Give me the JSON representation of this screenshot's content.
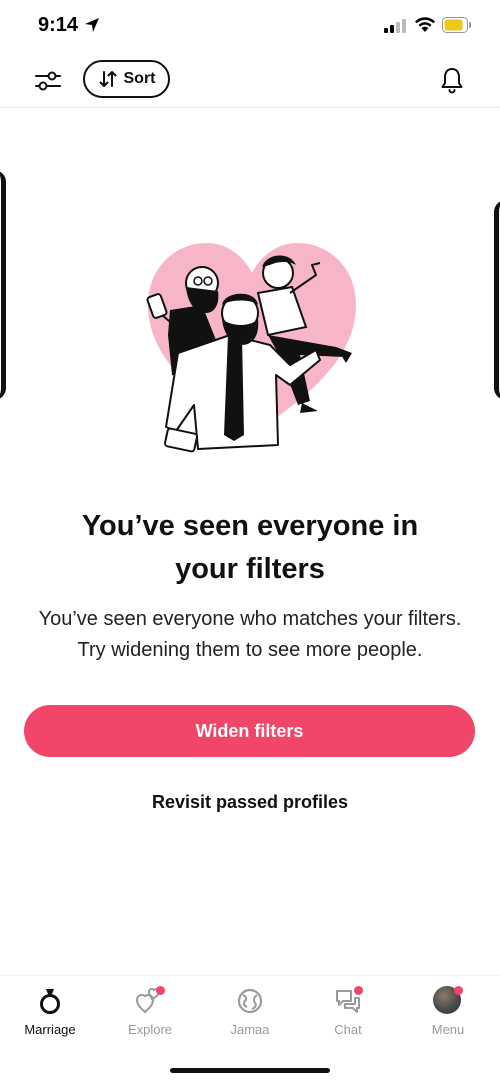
{
  "status_bar": {
    "time": "9:14"
  },
  "toolbar": {
    "filter_icon": "sliders-icon",
    "sort_label": "Sort",
    "sort_icon": "sort-arrows-icon",
    "notification_icon": "bell-icon"
  },
  "empty_state": {
    "title": "You’ve seen everyone in your filters",
    "description": "You’ve seen everyone who matches your filters. Try widening them to see more people.",
    "primary_button": "Widen filters",
    "secondary_link": "Revisit passed profiles"
  },
  "tabs": [
    {
      "label": "Marriage",
      "icon": "ring-icon",
      "active": true,
      "badge": false
    },
    {
      "label": "Explore",
      "icon": "hearts-icon",
      "active": false,
      "badge": true
    },
    {
      "label": "Jamaa",
      "icon": "globe-icon",
      "active": false,
      "badge": false
    },
    {
      "label": "Chat",
      "icon": "chat-icon",
      "active": false,
      "badge": true
    },
    {
      "label": "Menu",
      "icon": "avatar-icon",
      "active": false,
      "badge": true
    }
  ],
  "colors": {
    "accent": "#f2456a",
    "illustration_pink": "#f7b6c8",
    "text": "#111111",
    "muted": "#9a9a9a"
  }
}
